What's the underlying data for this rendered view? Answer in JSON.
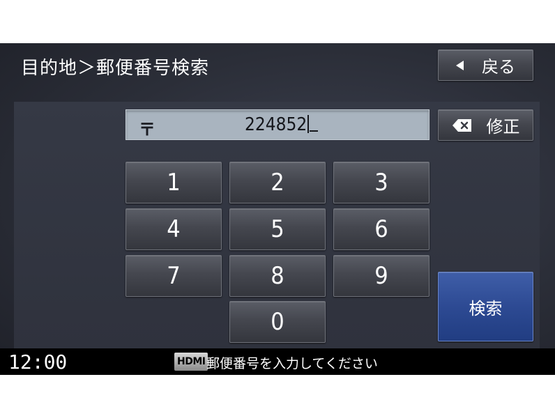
{
  "header": {
    "title": "目的地＞郵便番号検索",
    "back_label": "戻る"
  },
  "input": {
    "icon_glyph": "〒",
    "value": "224852"
  },
  "fix_label": "修正",
  "keypad": {
    "keys": [
      "1",
      "2",
      "3",
      "4",
      "5",
      "6",
      "7",
      "8",
      "9",
      "0"
    ]
  },
  "search_label": "検索",
  "status": {
    "time": "12:00",
    "source": "HDMI",
    "message": "郵便番号を入力してください"
  }
}
